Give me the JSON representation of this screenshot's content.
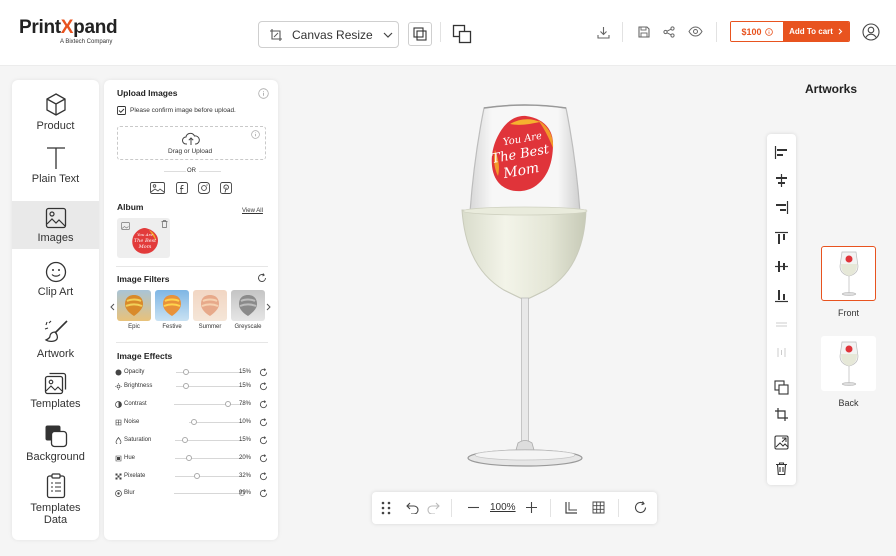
{
  "brand": {
    "name_pre": "Print",
    "name_x": "X",
    "name_post": "pand",
    "tagline": "A Bixtech Company",
    "accent": "#e8531f"
  },
  "toolbar": {
    "canvas_resize_label": "Canvas Resize",
    "price": "$100",
    "add_to_cart": "Add To cart"
  },
  "nav": {
    "items": [
      {
        "label": "Product",
        "icon": "cube-icon"
      },
      {
        "label": "Plain Text",
        "icon": "text-icon"
      },
      {
        "label": "Images",
        "icon": "image-icon",
        "active": true
      },
      {
        "label": "Clip Art",
        "icon": "smiley-icon"
      },
      {
        "label": "Artwork",
        "icon": "brush-icon"
      },
      {
        "label": "Templates",
        "icon": "templates-icon"
      },
      {
        "label": "Background",
        "icon": "background-icon"
      },
      {
        "label": "Templates Data",
        "icon": "clipboard-icon"
      }
    ]
  },
  "panel": {
    "upload_title": "Upload Images",
    "confirm_text": "Please confirm image before upload.",
    "drag_text": "Drag or Upload",
    "or_text": "OR",
    "album_title": "Album",
    "view_all": "View All",
    "filters_title": "Image Filters",
    "filters": [
      "Epic",
      "Festive",
      "Summer",
      "Greyscale"
    ],
    "effects_title": "Image Effects",
    "effects": [
      {
        "name": "Opacity",
        "value": "15%",
        "level": 0.15
      },
      {
        "name": "Brightness",
        "value": "15%",
        "level": 0.15
      },
      {
        "name": "Contrast",
        "value": "78%",
        "level": 0.78
      },
      {
        "name": "Noise",
        "value": "10%",
        "level": 0.1
      },
      {
        "name": "Saturation",
        "value": "15%",
        "level": 0.15
      },
      {
        "name": "Hue",
        "value": "20%",
        "level": 0.2
      },
      {
        "name": "Pixelate",
        "value": "32%",
        "level": 0.32
      },
      {
        "name": "Blur",
        "value": "99%",
        "level": 0.99
      }
    ]
  },
  "artwork": {
    "line1": "You Are",
    "line2": "The Best",
    "line3": "Mom"
  },
  "right": {
    "title": "Artworks",
    "views": [
      "Front",
      "Back"
    ]
  },
  "bottom": {
    "zoom": "100%"
  }
}
